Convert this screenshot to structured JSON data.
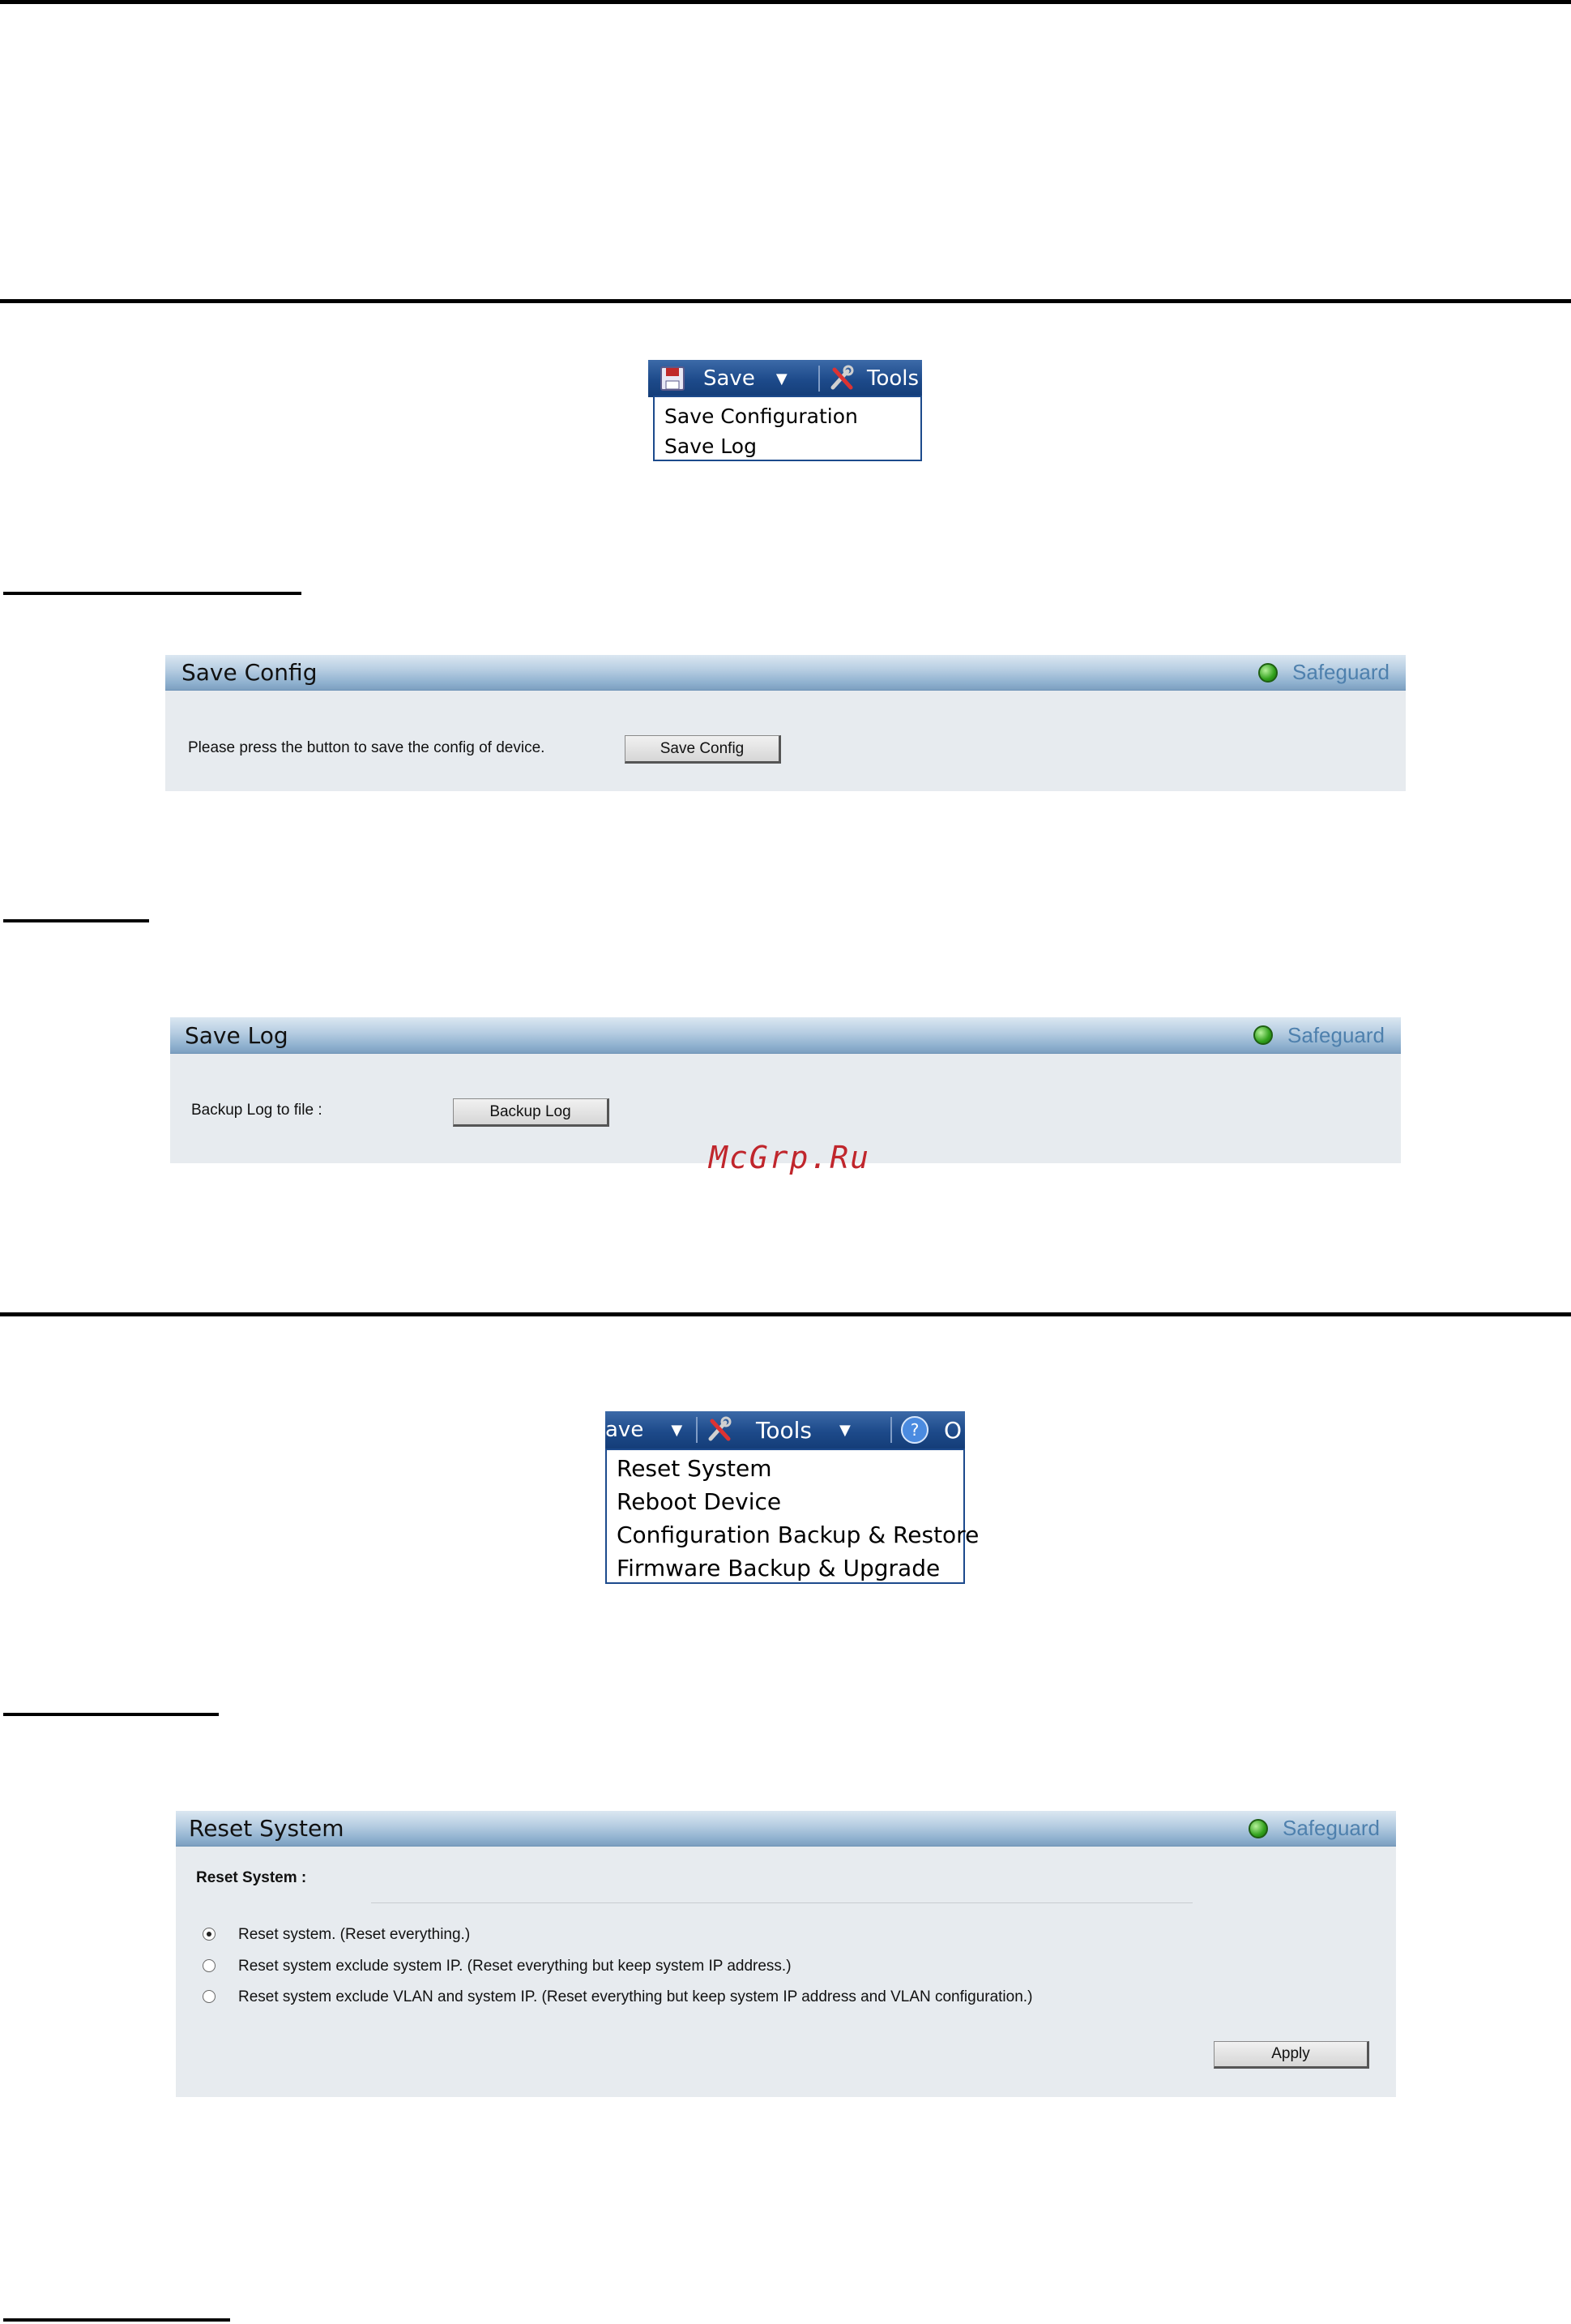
{
  "save_menu": {
    "save_label": "Save",
    "tools_label": "Tools",
    "items": [
      "Save Configuration",
      "Save Log"
    ]
  },
  "save_config_panel": {
    "title": "Save Config",
    "safeguard": "Safeguard",
    "prompt": "Please press the button to save the config of device.",
    "button": "Save Config"
  },
  "save_log_panel": {
    "title": "Save Log",
    "safeguard": "Safeguard",
    "label": "Backup Log to file :",
    "button": "Backup Log"
  },
  "watermark": "McGrp.Ru",
  "tools_menu": {
    "save_partial": "ave",
    "tools_label": "Tools",
    "help_partial": "O",
    "items": [
      "Reset System",
      "Reboot Device",
      "Configuration Backup & Restore",
      "Firmware Backup & Upgrade"
    ]
  },
  "reset_panel": {
    "title": "Reset System",
    "safeguard": "Safeguard",
    "section_label": "Reset System :",
    "options": [
      "Reset system. (Reset everything.)",
      "Reset system exclude system IP. (Reset everything but keep system IP address.)",
      "Reset system exclude VLAN and system IP. (Reset everything but keep system IP address and VLAN configuration.)"
    ],
    "selected_option": 0,
    "apply": "Apply"
  }
}
